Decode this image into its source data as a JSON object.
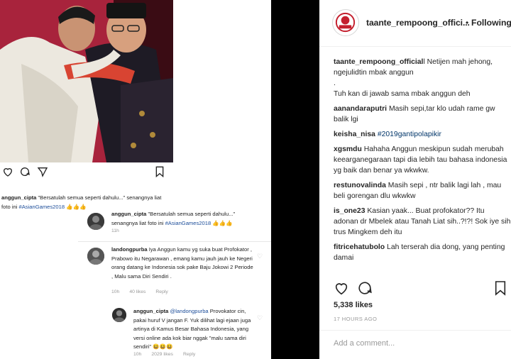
{
  "left_post": {
    "caption": {
      "user": "anggun_cipta",
      "text": " \"Bersatulah semua seperti dahulu...\" senangnya liat foto ini ",
      "hashtag": "#AsianGames2018",
      "emoji": " 👍👍👍"
    },
    "comment_main": {
      "user": "anggun_cipta",
      "text": " \"Bersatulah semua seperti dahulu...\" senangnya liat foto ini ",
      "hashtag": "#AsianGames2018",
      "emoji": " 👍👍👍",
      "time": "11h"
    },
    "reply1": {
      "user": "landongpurba",
      "text": " Iya Anggun kamu yg suka buat Profokator , Prabowo itu Negarawan , emang kamu jauh jauh ke Negeri orang datang ke Indonesia sok pake Baju Jokowi 2 Periode , Malu sama Diri Sendiri .",
      "time": "10h",
      "likes": "40 likes",
      "reply": "Reply"
    },
    "reply2": {
      "user": "anggun_cipta",
      "mention": " @landongpurba",
      "text": " Provokator cin, pakai huruf V jangan F. Yuk dilihat lagi ejaan juga artinya di Kamus Besar Bahasa Indonesia, yang versi online ada kok biar nggak \"malu sama diri sendiri\" 😆😆😆",
      "time": "10h",
      "likes": "2029 likes",
      "reply": "Reply"
    }
  },
  "header": {
    "username": "taante_rempoong_offici...",
    "separator": "•",
    "follow_label": "Following"
  },
  "comments": [
    {
      "user": "taante_rempoong_official",
      "text": "l Netijen mah jehong, ngejulidtin mbak anggun"
    },
    {
      "user": "",
      "text": "."
    },
    {
      "user": "",
      "text": "Tuh kan di jawab sama mbak anggun deh"
    },
    {
      "user": "aanandaraputri",
      "text": " Masih sepi,tar klo udah rame gw balik lgi"
    },
    {
      "user": "keisha_nisa",
      "text": " ",
      "hashtag": "#2019gantipolapikir"
    },
    {
      "user": "xgsmdu",
      "text": " Hahaha Anggun meskipun sudah merubah keearganegaraan tapi dia lebih tau bahasa indonesia yg baik dan benar ya wkwkw."
    },
    {
      "user": "restunovalinda",
      "text": " Masih sepi , ntr balik lagi lah , mau beli gorengan dlu wkwkw"
    },
    {
      "user": "is_one23",
      "text": " Kasian yaak... Buat profokator?? Itu adonan dr Mbelek atau Tanah Liat sih..?!?! Sok iye sih trus Mingkem deh itu"
    },
    {
      "user": "fitricehatubolo",
      "text": " Lah terserah dia dong, yang penting damai"
    }
  ],
  "likes": "5,338 likes",
  "timestamp": "17 HOURS AGO",
  "add_comment": {
    "placeholder": "Add a comment..."
  },
  "colors": {
    "hashtag": "#003569",
    "username": "#262626",
    "muted": "#999999",
    "photo_bg": "#a8233c"
  }
}
